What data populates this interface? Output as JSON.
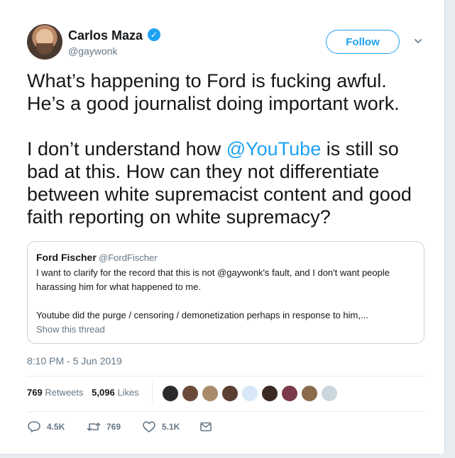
{
  "author": {
    "name": "Carlos Maza",
    "handle": "@gaywonk",
    "verified_mark": "✓"
  },
  "follow_label": "Follow",
  "tweet": {
    "paragraph1": "What’s happening to Ford is fucking awful.\nHe’s a good journalist doing important work.",
    "p2_before": "I don’t understand how ",
    "p2_mention": "@YouTube",
    "p2_after": " is still so bad at this. How can they not differentiate between white supremacist content and good faith reporting on white supremacy?"
  },
  "quote": {
    "name": "Ford Fischer",
    "handle": "@FordFischer",
    "text1": "I want to clarify for the record that this is not @gaywonk's fault, and I don't want people harassing him for what happened to me.",
    "text2": "Youtube did the purge / censoring / demonetization perhaps in response to him,...",
    "link": "Show this thread"
  },
  "timestamp": "8:10 PM - 5 Jun 2019",
  "stats": {
    "retweets_count": "769",
    "retweets_label": "Retweets",
    "likes_count": "5,096",
    "likes_label": "Likes"
  },
  "likers": [
    "avatar",
    "avatar",
    "avatar",
    "avatar",
    "avatar",
    "avatar",
    "avatar",
    "avatar",
    "avatar"
  ],
  "actions": {
    "reply_count": "4.5K",
    "retweet_count": "769",
    "like_count": "5.1K"
  },
  "colors": {
    "accent": "#1da1f2",
    "text": "#14171a",
    "secondary": "#657786",
    "background": "#e6ecf0"
  },
  "icons": [
    "verified-icon",
    "chevron-down-icon",
    "reply-icon",
    "retweet-icon",
    "like-icon",
    "dm-icon"
  ]
}
